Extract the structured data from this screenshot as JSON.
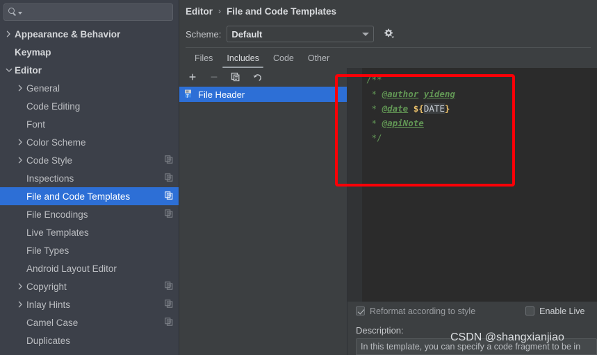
{
  "search": {
    "value": "",
    "placeholder": "",
    "icon": "search-icon"
  },
  "sidebar": {
    "items": [
      {
        "label": "Appearance & Behavior",
        "level": 0,
        "arrow": "right",
        "bold": true,
        "config_icon": false,
        "selected": false
      },
      {
        "label": "Keymap",
        "level": 0,
        "arrow": "none",
        "bold": true,
        "config_icon": false,
        "selected": false
      },
      {
        "label": "Editor",
        "level": 0,
        "arrow": "down",
        "bold": true,
        "config_icon": false,
        "selected": false
      },
      {
        "label": "General",
        "level": 1,
        "arrow": "right",
        "bold": false,
        "config_icon": false,
        "selected": false
      },
      {
        "label": "Code Editing",
        "level": 1,
        "arrow": "none",
        "bold": false,
        "config_icon": false,
        "selected": false
      },
      {
        "label": "Font",
        "level": 1,
        "arrow": "none",
        "bold": false,
        "config_icon": false,
        "selected": false
      },
      {
        "label": "Color Scheme",
        "level": 1,
        "arrow": "right",
        "bold": false,
        "config_icon": false,
        "selected": false
      },
      {
        "label": "Code Style",
        "level": 1,
        "arrow": "right",
        "bold": false,
        "config_icon": true,
        "selected": false
      },
      {
        "label": "Inspections",
        "level": 1,
        "arrow": "none",
        "bold": false,
        "config_icon": true,
        "selected": false
      },
      {
        "label": "File and Code Templates",
        "level": 1,
        "arrow": "none",
        "bold": false,
        "config_icon": true,
        "selected": true
      },
      {
        "label": "File Encodings",
        "level": 1,
        "arrow": "none",
        "bold": false,
        "config_icon": true,
        "selected": false
      },
      {
        "label": "Live Templates",
        "level": 1,
        "arrow": "none",
        "bold": false,
        "config_icon": false,
        "selected": false
      },
      {
        "label": "File Types",
        "level": 1,
        "arrow": "none",
        "bold": false,
        "config_icon": false,
        "selected": false
      },
      {
        "label": "Android Layout Editor",
        "level": 1,
        "arrow": "none",
        "bold": false,
        "config_icon": false,
        "selected": false
      },
      {
        "label": "Copyright",
        "level": 1,
        "arrow": "right",
        "bold": false,
        "config_icon": true,
        "selected": false
      },
      {
        "label": "Inlay Hints",
        "level": 1,
        "arrow": "right",
        "bold": false,
        "config_icon": true,
        "selected": false
      },
      {
        "label": "Camel Case",
        "level": 1,
        "arrow": "none",
        "bold": false,
        "config_icon": true,
        "selected": false
      },
      {
        "label": "Duplicates",
        "level": 1,
        "arrow": "none",
        "bold": false,
        "config_icon": false,
        "selected": false
      }
    ]
  },
  "breadcrumb": {
    "parent": "Editor",
    "separator": "›",
    "current": "File and Code Templates"
  },
  "scheme": {
    "label": "Scheme:",
    "value": "Default",
    "options": [
      "Default"
    ],
    "gear_icon": "gear-icon"
  },
  "tabs": [
    {
      "label": "Files",
      "active": false
    },
    {
      "label": "Includes",
      "active": true
    },
    {
      "label": "Code",
      "active": false
    },
    {
      "label": "Other",
      "active": false
    }
  ],
  "list_toolbar": [
    {
      "name": "add-template-button",
      "glyph": "+",
      "enabled": true
    },
    {
      "name": "remove-template-button",
      "glyph": "−",
      "enabled": false
    },
    {
      "name": "copy-template-button",
      "glyph": "copy",
      "enabled": true
    },
    {
      "name": "reset-template-button",
      "glyph": "undo",
      "enabled": true
    }
  ],
  "templates": [
    {
      "label": "File Header",
      "selected": true,
      "icon": "template-file-icon"
    }
  ],
  "editor": {
    "lines": [
      [
        {
          "t": "/**",
          "c": "green"
        }
      ],
      [
        {
          "t": " * ",
          "c": "green"
        },
        {
          "t": "@author",
          "c": "tag"
        },
        {
          "t": " ",
          "c": "green"
        },
        {
          "t": "yideng",
          "c": "typo"
        }
      ],
      [
        {
          "t": " * ",
          "c": "green"
        },
        {
          "t": "@date",
          "c": "tag"
        },
        {
          "t": " ",
          "c": "green"
        },
        {
          "t": "${",
          "c": "brace"
        },
        {
          "t": "DATE",
          "c": "var"
        },
        {
          "t": "}",
          "c": "brace"
        }
      ],
      [
        {
          "t": " * ",
          "c": "green"
        },
        {
          "t": "@apiNote",
          "c": "tag"
        }
      ],
      [
        {
          "t": " */",
          "c": "green"
        }
      ]
    ]
  },
  "options": {
    "reformat": {
      "label": "Reformat according to style",
      "checked": true
    },
    "live_templates": {
      "label": "Enable Live",
      "checked": false
    }
  },
  "description": {
    "label": "Description:",
    "text": "In this template, you can specify a code fragment to be in"
  },
  "watermark": "CSDN @shangxianjiao",
  "colors": {
    "selection_blue": "#2d6fd6",
    "annotation_red": "#fb0007",
    "editor_bg": "#2b2b2b",
    "panel_bg": "#3c3f41",
    "sidebar_bg": "#3c4049",
    "comment_green": "#629755",
    "macro_yellow": "#e8bf6a"
  }
}
